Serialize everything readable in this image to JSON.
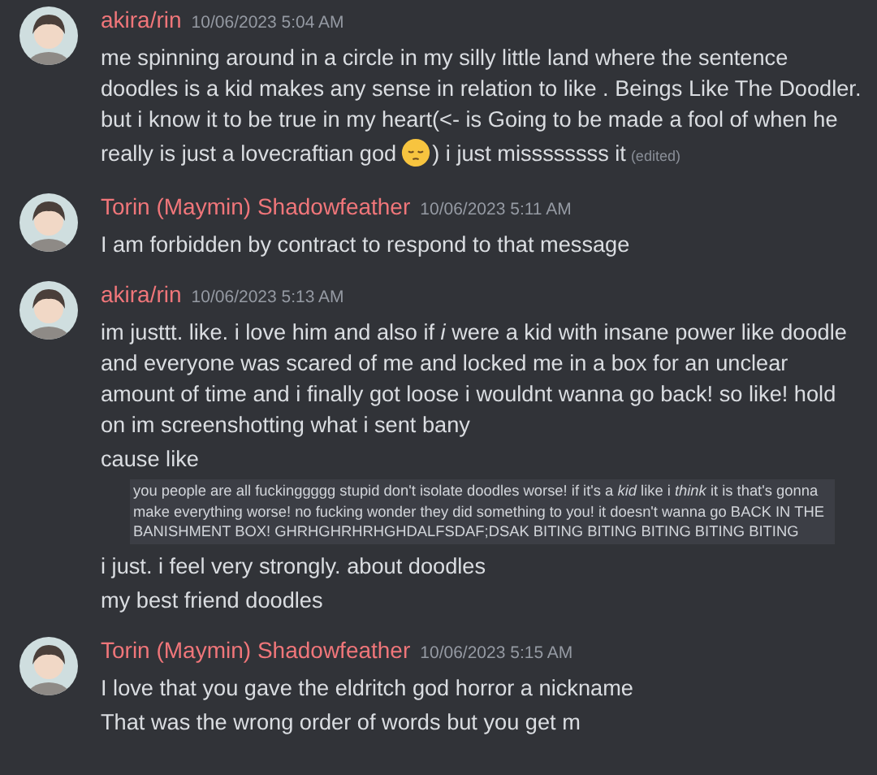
{
  "messages": [
    {
      "author": "akira/rin",
      "avatar": {
        "kind": "picture"
      },
      "timestamp": "10/06/2023 5:04 AM",
      "lines": [
        {
          "kind": "text",
          "parts": [
            {
              "kind": "text",
              "text": "me spinning around in a circle in my silly little land where the sentence doodles is a kid makes any sense in relation to like . Beings Like The Doodler. but i know it to be true in my heart(<- is Going to be made a fool of when he"
            }
          ]
        },
        {
          "kind": "text",
          "parts": [
            {
              "kind": "text",
              "text": "really is just a lovecraftian god"
            },
            {
              "kind": "emoji"
            },
            {
              "kind": "text",
              "text": ") i just missssssss it"
            },
            {
              "kind": "edited",
              "text": "(edited)"
            }
          ]
        }
      ]
    },
    {
      "author": "Torin (Maymin) Shadowfeather",
      "avatar": {
        "kind": "picture"
      },
      "timestamp": "10/06/2023 5:11 AM",
      "lines": [
        {
          "kind": "text",
          "parts": [
            {
              "kind": "text",
              "text": "I am forbidden by contract to respond to that message"
            }
          ]
        }
      ]
    },
    {
      "author": "akira/rin",
      "avatar": {
        "kind": "picture"
      },
      "timestamp": "10/06/2023 5:13 AM",
      "lines": [
        {
          "kind": "text",
          "parts": [
            {
              "kind": "text",
              "text": "im justtt. like. i love him and also if *i* were a kid with insane power like doodle and everyone was scared of me and locked me in a box for an unclear amount of time and i finally got loose i wouldnt wanna go back! so like! hold on im screenshotting what i sent bany"
            }
          ]
        },
        {
          "kind": "text",
          "parts": [
            {
              "kind": "text",
              "text": "cause like"
            }
          ]
        },
        {
          "kind": "quote",
          "text": "you people are all fuckinggggg stupid don't isolate doodles worse! if it's a *kid* like i *think* it is that's gonna make everything worse! no fucking wonder they did something to you! it doesn't wanna go BACK IN THE BANISHMENT BOX! GHRHGHRHRHGHDALFSDAF;DSAK BITING BITING BITING BITING BITING"
        },
        {
          "kind": "text",
          "parts": [
            {
              "kind": "text",
              "text": "i just. i feel very strongly. about doodles"
            }
          ]
        },
        {
          "kind": "text",
          "parts": [
            {
              "kind": "text",
              "text": "my best friend doodles"
            }
          ]
        }
      ]
    },
    {
      "author": "Torin (Maymin) Shadowfeather",
      "avatar": {
        "kind": "picture"
      },
      "timestamp": "10/06/2023 5:15 AM",
      "lines": [
        {
          "kind": "text",
          "parts": [
            {
              "kind": "text",
              "text": "I love that you gave the eldritch god horror a nickname"
            }
          ]
        },
        {
          "kind": "text",
          "parts": [
            {
              "kind": "text",
              "text": "That was the wrong order of words but you get m"
            }
          ]
        }
      ]
    }
  ]
}
